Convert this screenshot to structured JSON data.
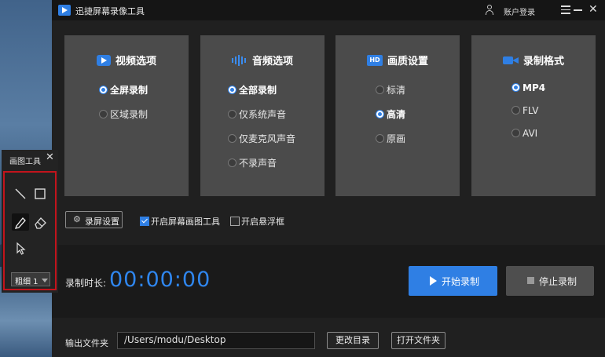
{
  "app": {
    "title": "迅捷屏幕录像工具",
    "login": "账户登录"
  },
  "panels": [
    {
      "title": "视频选项",
      "icon": "video-icon",
      "options": [
        {
          "label": "全屏录制",
          "selected": true
        },
        {
          "label": "区域录制",
          "selected": false
        }
      ]
    },
    {
      "title": "音频选项",
      "icon": "audio-wave-icon",
      "options": [
        {
          "label": "全部录制",
          "selected": true
        },
        {
          "label": "仅系统声音",
          "selected": false
        },
        {
          "label": "仅麦克风声音",
          "selected": false
        },
        {
          "label": "不录声音",
          "selected": false
        }
      ]
    },
    {
      "title": "画质设置",
      "icon": "hd-icon",
      "options": [
        {
          "label": "标清",
          "selected": false
        },
        {
          "label": "高清",
          "selected": true
        },
        {
          "label": "原画",
          "selected": false
        }
      ]
    },
    {
      "title": "录制格式",
      "icon": "camera-icon",
      "options": [
        {
          "label": "MP4",
          "selected": true
        },
        {
          "label": "FLV",
          "selected": false
        },
        {
          "label": "AVI",
          "selected": false
        }
      ]
    }
  ],
  "settings": {
    "record_settings_label": "录屏设置",
    "drawing_tool_label": "开启屏幕画图工具",
    "drawing_tool_checked": true,
    "floating_box_label": "开启悬浮框",
    "floating_box_checked": false
  },
  "recording": {
    "duration_label": "录制时长:",
    "timer": "00:00:00",
    "start_label": "开始录制",
    "stop_label": "停止录制"
  },
  "output": {
    "label": "输出文件夹",
    "path": "/Users/modu/Desktop",
    "change_dir_label": "更改目录",
    "open_folder_label": "打开文件夹"
  },
  "drawing_toolbox": {
    "title": "画图工具",
    "tools": [
      "line-tool-icon",
      "rectangle-tool-icon",
      "pen-tool-icon",
      "eraser-tool-icon",
      "pointer-tool-icon"
    ],
    "active_tool": "pen-tool-icon",
    "thickness": "粗细 1"
  },
  "colors": {
    "accent": "#2f7fe4",
    "highlight_frame": "#c2141c"
  }
}
